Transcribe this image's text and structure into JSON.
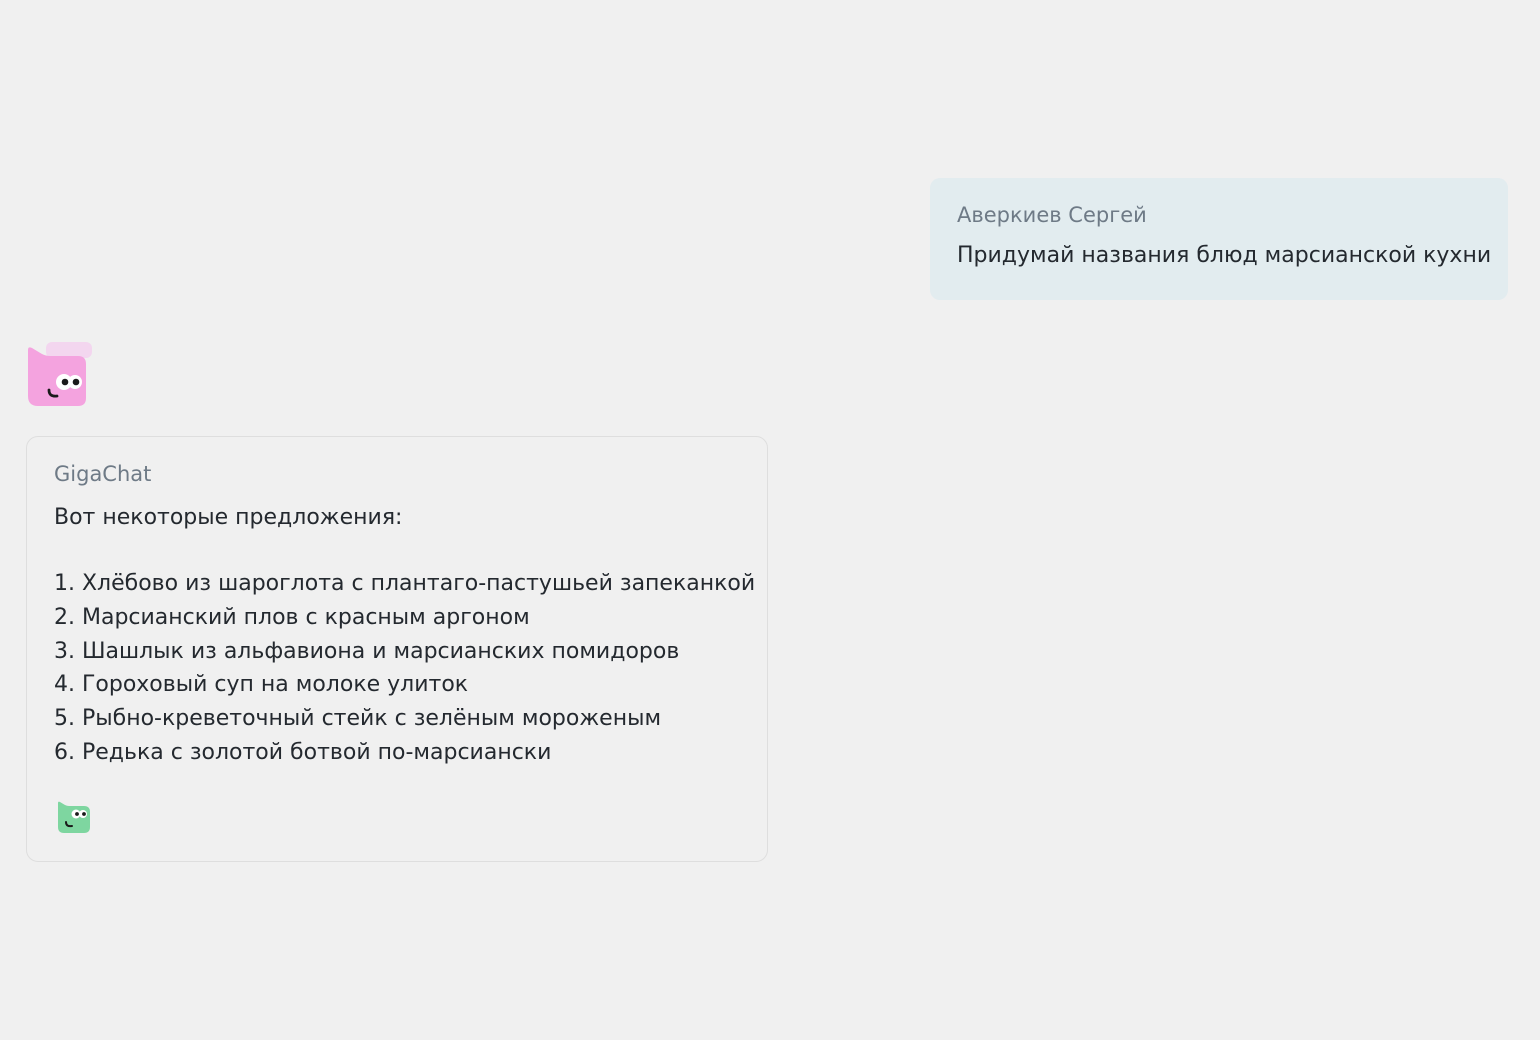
{
  "user_message": {
    "author": "Аверкиев Сергей",
    "text": "Придумай названия блюд марсианской кухни"
  },
  "bot_avatar": {
    "icon": "gigachat-avatar-icon",
    "color": "#f4a3df"
  },
  "bot_message": {
    "author": "GigaChat",
    "intro": "Вот некоторые предложения:",
    "items": [
      "1. Хлёбово из шароглота с плантаго-пастушьей запеканкой",
      "2. Марсианский плов с красным аргоном",
      "3. Шашлык из альфавиона и марсианских помидоров",
      "4. Гороховый суп на молоке улиток",
      "5. Рыбно-креветочный стейк с зелёным мороженым",
      "6. Редька с золотой ботвой по-марсиански"
    ],
    "footer_icon": "gigachat-green-icon",
    "footer_icon_color": "#7ed6a0"
  },
  "colors": {
    "background": "#f0f0f0",
    "user_bubble": "#e2ecef",
    "author_text": "#6e7a86",
    "body_text": "#24292f"
  }
}
